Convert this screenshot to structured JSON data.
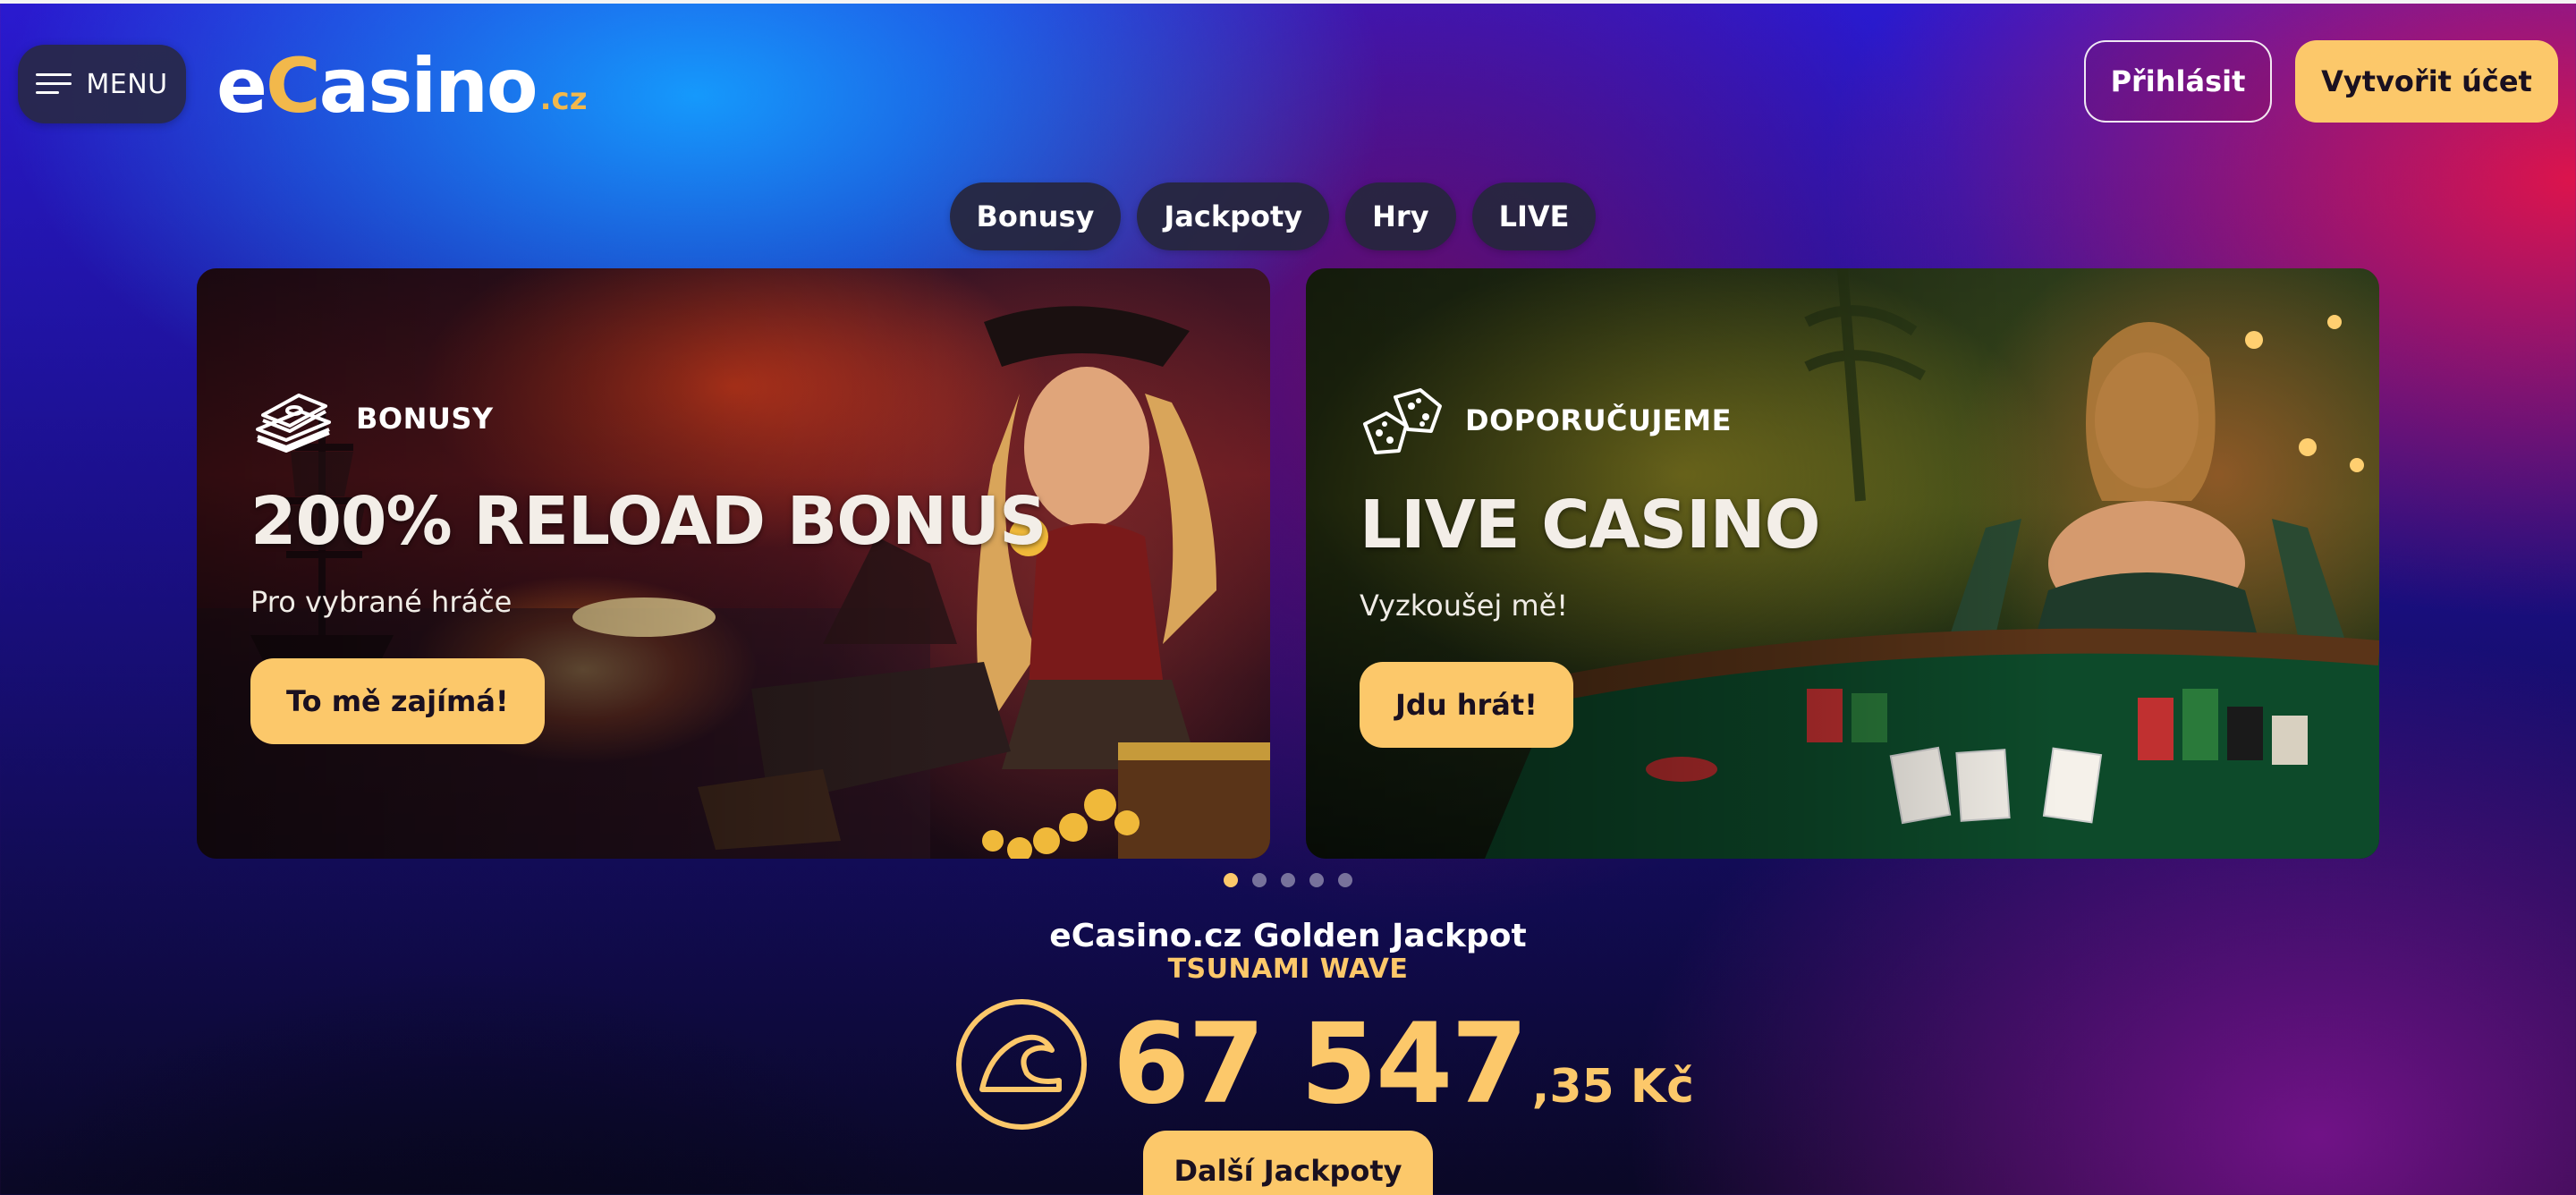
{
  "header": {
    "menu_label": "MENU",
    "logo": {
      "prefix": "e",
      "accent": "C",
      "rest": "asino",
      "tld": ".cz"
    },
    "login_label": "Přihlásit",
    "register_label": "Vytvořit účet"
  },
  "categories": [
    {
      "label": "Bonusy"
    },
    {
      "label": "Jackpoty"
    },
    {
      "label": "Hry"
    },
    {
      "label": "LIVE"
    }
  ],
  "banners": [
    {
      "tag": "BONUSY",
      "tag_icon": "money-stack-icon",
      "title": "200% RELOAD BONUS",
      "subtitle": "Pro vybrané hráče",
      "cta": "To mě zajímá!",
      "art": "pirate-woman-with-treasure"
    },
    {
      "tag": "DOPORUČUJEME",
      "tag_icon": "dice-icon",
      "title": "LIVE CASINO",
      "subtitle": "Vyzkoušej mě!",
      "cta": "Jdu hrát!",
      "art": "dealer-at-card-table"
    }
  ],
  "carousel": {
    "total": 5,
    "active_index": 0
  },
  "jackpot": {
    "title": "eCasino.cz Golden Jackpot",
    "subtitle": "TSUNAMI WAVE",
    "icon": "wave-coin-icon",
    "amount_main": "67 547",
    "amount_cents": ",35 Kč",
    "cta": "Další Jackpoty"
  },
  "colors": {
    "accent": "#fcc86a",
    "chip_bg": "#26263e",
    "menu_bg": "#282846"
  }
}
